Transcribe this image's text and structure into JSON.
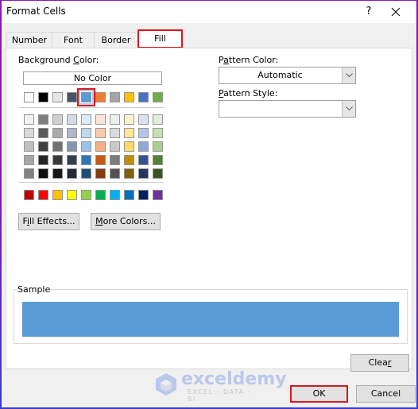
{
  "window": {
    "title": "Format Cells",
    "help_label": "?",
    "close_label": "✕"
  },
  "tabs": [
    {
      "label": "Number",
      "active": false
    },
    {
      "label": "Font",
      "active": false
    },
    {
      "label": "Border",
      "active": false
    },
    {
      "label": "Fill",
      "active": true
    }
  ],
  "background_color": {
    "label_pre": "Background ",
    "label_u": "C",
    "label_post": "olor:",
    "no_color_label": "No Color",
    "theme_row": [
      "#ffffff",
      "#000000",
      "#e7e6e6",
      "#44546a",
      "#5b9bd5",
      "#ed7d31",
      "#a5a5a5",
      "#ffc000",
      "#4472c4",
      "#70ad47"
    ],
    "selected_index": 4,
    "tint_rows": [
      [
        "#f2f2f2",
        "#7f7f7f",
        "#d0cece",
        "#d6dce4",
        "#ddebf7",
        "#fce4d6",
        "#ededed",
        "#fff2cc",
        "#d9e1f2",
        "#e2efda"
      ],
      [
        "#d9d9d9",
        "#595959",
        "#aeaaaa",
        "#acb9ca",
        "#bdd7ee",
        "#f8cbad",
        "#dbdbdb",
        "#ffe699",
        "#b4c6e7",
        "#c6e0b4"
      ],
      [
        "#bfbfbf",
        "#404040",
        "#757171",
        "#8497b0",
        "#9bc2e6",
        "#f4b084",
        "#c9c9c9",
        "#ffd966",
        "#8ea9db",
        "#a9d08e"
      ],
      [
        "#a6a6a6",
        "#262626",
        "#3a3838",
        "#333f4f",
        "#2f75b5",
        "#c65911",
        "#7b7b7b",
        "#bf8f00",
        "#305496",
        "#548235"
      ],
      [
        "#808080",
        "#0d0d0d",
        "#161616",
        "#222b35",
        "#1f4e78",
        "#833c0c",
        "#525252",
        "#806000",
        "#203764",
        "#375623"
      ]
    ],
    "standard_row": [
      "#c00000",
      "#ff0000",
      "#ffc000",
      "#ffff00",
      "#92d050",
      "#00b050",
      "#00b0f0",
      "#0070c0",
      "#002060",
      "#7030a0"
    ]
  },
  "buttons": {
    "fill_effects_pre": "F",
    "fill_effects_u": "i",
    "fill_effects_post": "ll Effects...",
    "more_colors_u": "M",
    "more_colors_post": "ore Colors...",
    "clear_pre": "Clea",
    "clear_u": "r",
    "ok": "OK",
    "cancel": "Cancel"
  },
  "pattern_color": {
    "label_pre": "P",
    "label_u": "a",
    "label_post": "ttern Color:",
    "value": "Automatic"
  },
  "pattern_style": {
    "label_u": "P",
    "label_post": "attern Style:",
    "value": ""
  },
  "sample": {
    "label": "Sample",
    "color": "#5b9bd5"
  },
  "watermark": {
    "name": "exceldemy",
    "tagline": "EXCEL - DATA - BI"
  },
  "highlight_color": "#e0141e"
}
